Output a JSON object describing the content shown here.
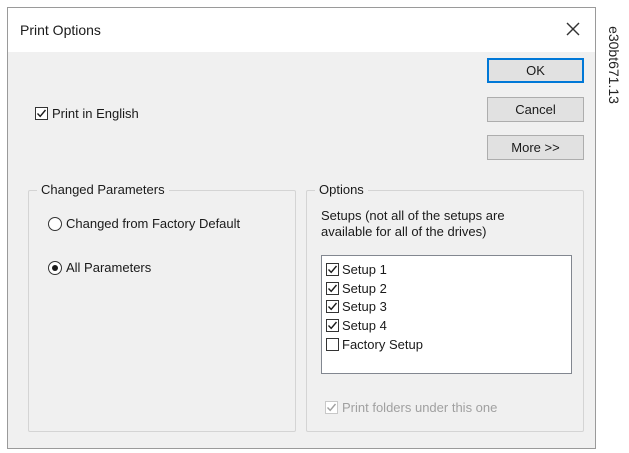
{
  "dialog": {
    "title": "Print Options",
    "close_symbol": "✕",
    "buttons": {
      "ok": "OK",
      "cancel": "Cancel",
      "more": "More >>"
    },
    "print_in_english": {
      "label": "Print in English",
      "checked": true
    },
    "changed_parameters": {
      "legend": "Changed Parameters",
      "options": [
        {
          "label": "Changed from Factory Default",
          "selected": false
        },
        {
          "label": "All Parameters",
          "selected": true
        }
      ]
    },
    "options_group": {
      "legend": "Options",
      "description_line1": "Setups (not all of the setups are",
      "description_line2": "available for all of the drives)",
      "setups": [
        {
          "label": "Setup 1",
          "checked": true
        },
        {
          "label": "Setup 2",
          "checked": true
        },
        {
          "label": "Setup 3",
          "checked": true
        },
        {
          "label": "Setup 4",
          "checked": true
        },
        {
          "label": "Factory Setup",
          "checked": false
        }
      ],
      "print_folders": {
        "label": "Print folders under this one",
        "checked": true,
        "disabled": true
      }
    }
  },
  "figure_code": "e30bt671.13",
  "colors": {
    "dialog_bg": "#f0f0f0",
    "titlebar_bg": "#ffffff",
    "default_button_border": "#0078d7",
    "disabled_text": "#a0a0a0"
  }
}
